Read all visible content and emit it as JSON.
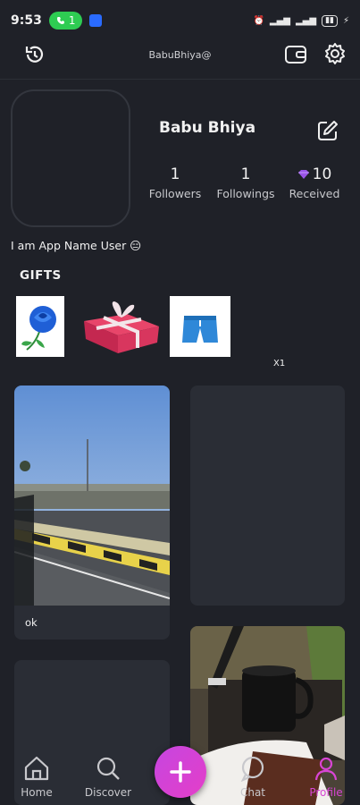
{
  "status_bar": {
    "time": "9:53",
    "call_count": "1"
  },
  "header": {
    "handle": "BabuBhiya@"
  },
  "profile": {
    "name": "Babu Bhiya",
    "bio": "I am App Name User 😑",
    "stats": [
      {
        "value": "1",
        "label": "Followers"
      },
      {
        "value": "1",
        "label": "Followings"
      },
      {
        "value": "10",
        "label": "Received"
      }
    ]
  },
  "gifts": {
    "title": "GIFTS",
    "items": [
      {
        "name": "blue-rose"
      },
      {
        "name": "gift-box"
      },
      {
        "name": "shorts"
      }
    ],
    "count": "X1"
  },
  "posts": [
    {
      "caption": "ok",
      "kind": "road-video"
    },
    {
      "caption": "",
      "kind": "empty"
    },
    {
      "caption": "",
      "kind": "empty"
    },
    {
      "caption": "",
      "kind": "coffee-cake"
    }
  ],
  "nav": {
    "items": [
      {
        "label": "Home",
        "icon": "home-icon"
      },
      {
        "label": "Discover",
        "icon": "search-icon"
      },
      {
        "label": "Chat",
        "icon": "chat-icon"
      },
      {
        "label": "Profile",
        "icon": "profile-icon"
      }
    ]
  },
  "colors": {
    "background": "#1f2128",
    "card": "#2a2d35",
    "accent": "#d845d4",
    "diamond": "#9a55e8"
  }
}
